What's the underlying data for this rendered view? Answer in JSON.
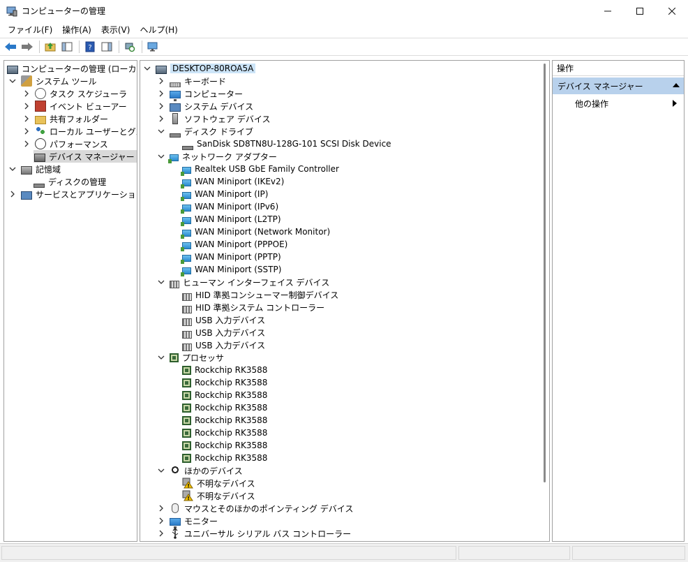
{
  "window": {
    "title": "コンピューターの管理",
    "minimize": "—",
    "maximize": "☐",
    "close": "✕"
  },
  "menu": [
    "ファイル(F)",
    "操作(A)",
    "表示(V)",
    "ヘルプ(H)"
  ],
  "toolbar": {
    "icons": [
      "back-arrow-icon",
      "forward-arrow-icon",
      "up-folder-icon",
      "show-hide-tree-icon",
      "help-icon",
      "show-hide-action-icon",
      "scan-hardware-icon",
      "properties-icon"
    ]
  },
  "left_tree": {
    "root": "コンピューターの管理 (ローカル)",
    "system_tools": "システム ツール",
    "task_scheduler": "タスク スケジューラ",
    "event_viewer": "イベント ビューアー",
    "shared_folders": "共有フォルダー",
    "local_users": "ローカル ユーザーとグループ",
    "performance": "パフォーマンス",
    "device_manager": "デバイス マネージャー",
    "storage": "記憶域",
    "disk_management": "ディスクの管理",
    "services_apps": "サービスとアプリケーション"
  },
  "device_tree": {
    "root": "DESKTOP-80ROA5A",
    "keyboard": "キーボード",
    "computer": "コンピューター",
    "system_devices": "システム デバイス",
    "software_devices": "ソフトウェア デバイス",
    "disk_drives": "ディスク ドライブ",
    "disk_items": [
      "SanDisk SD8TN8U-128G-101 SCSI Disk Device"
    ],
    "network_adapters": "ネットワーク アダプター",
    "network_items": [
      "Realtek USB GbE Family Controller",
      "WAN Miniport (IKEv2)",
      "WAN Miniport (IP)",
      "WAN Miniport (IPv6)",
      "WAN Miniport (L2TP)",
      "WAN Miniport (Network Monitor)",
      "WAN Miniport (PPPOE)",
      "WAN Miniport (PPTP)",
      "WAN Miniport (SSTP)"
    ],
    "hid": "ヒューマン インターフェイス デバイス",
    "hid_items": [
      "HID 準拠コンシューマー制御デバイス",
      "HID 準拠システム コントローラー",
      "USB 入力デバイス",
      "USB 入力デバイス",
      "USB 入力デバイス"
    ],
    "processors": "プロセッサ",
    "processor_items": [
      "Rockchip RK3588",
      "Rockchip RK3588",
      "Rockchip RK3588",
      "Rockchip RK3588",
      "Rockchip RK3588",
      "Rockchip RK3588",
      "Rockchip RK3588",
      "Rockchip RK3588"
    ],
    "other_devices": "ほかのデバイス",
    "other_items": [
      "不明なデバイス",
      "不明なデバイス"
    ],
    "mice": "マウスとそのほかのポインティング デバイス",
    "monitors": "モニター",
    "usb_controllers": "ユニバーサル シリアル バス コントローラー"
  },
  "actions": {
    "header": "操作",
    "section": "デバイス マネージャー",
    "more": "他の操作"
  }
}
